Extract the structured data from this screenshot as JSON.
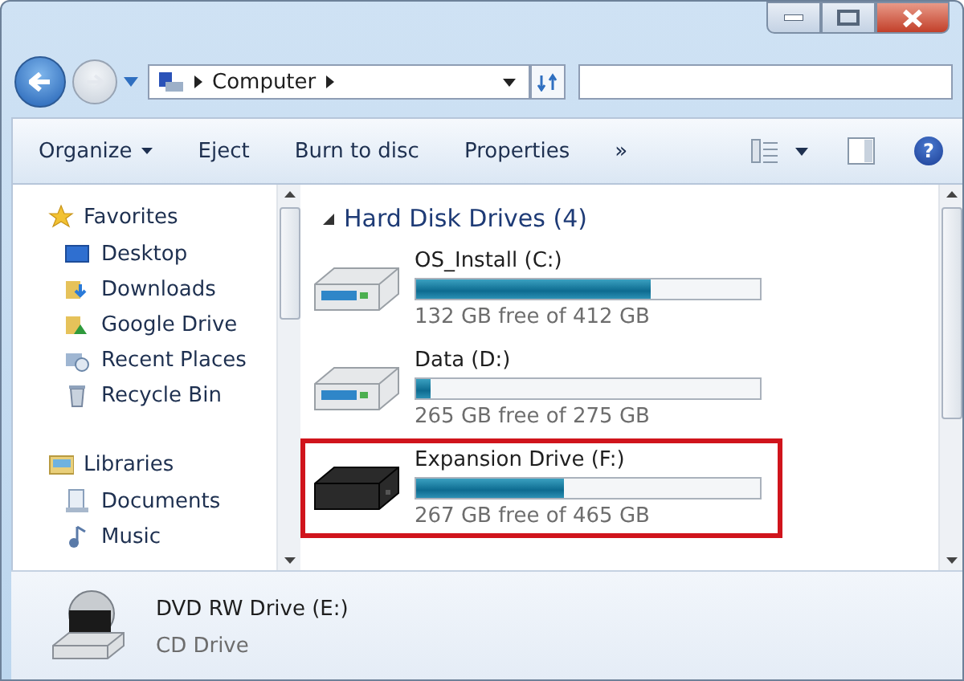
{
  "address_bar": {
    "path": [
      {
        "label": "Computer"
      }
    ]
  },
  "toolbar": {
    "buttons": [
      {
        "label": "Organize",
        "dropdown": true
      },
      {
        "label": "Eject",
        "dropdown": false
      },
      {
        "label": "Burn to disc",
        "dropdown": false
      },
      {
        "label": "Properties",
        "dropdown": false
      }
    ],
    "overflow": "»",
    "help": "?"
  },
  "sidebar": {
    "groups": [
      {
        "label": "Favorites",
        "items": [
          {
            "label": "Desktop"
          },
          {
            "label": "Downloads"
          },
          {
            "label": "Google Drive"
          },
          {
            "label": "Recent Places"
          },
          {
            "label": "Recycle Bin"
          }
        ]
      },
      {
        "label": "Libraries",
        "items": [
          {
            "label": "Documents"
          },
          {
            "label": "Music"
          }
        ]
      }
    ]
  },
  "content": {
    "group": {
      "title": "Hard Disk Drives (4)",
      "expanded": true
    },
    "drives": [
      {
        "name": "OS_Install (C:)",
        "level": 0.68,
        "free": "132 GB free of 412 GB",
        "kind": "silver",
        "highlighted": false
      },
      {
        "name": "Data (D:)",
        "level": 0.04,
        "free": "265 GB free of 275 GB",
        "kind": "silver",
        "highlighted": false
      },
      {
        "name": "Expansion Drive (F:)",
        "level": 0.43,
        "free": "267 GB free of 465 GB",
        "kind": "black",
        "highlighted": true
      }
    ]
  },
  "details": {
    "name": "DVD RW Drive (E:)",
    "type": "CD Drive"
  }
}
